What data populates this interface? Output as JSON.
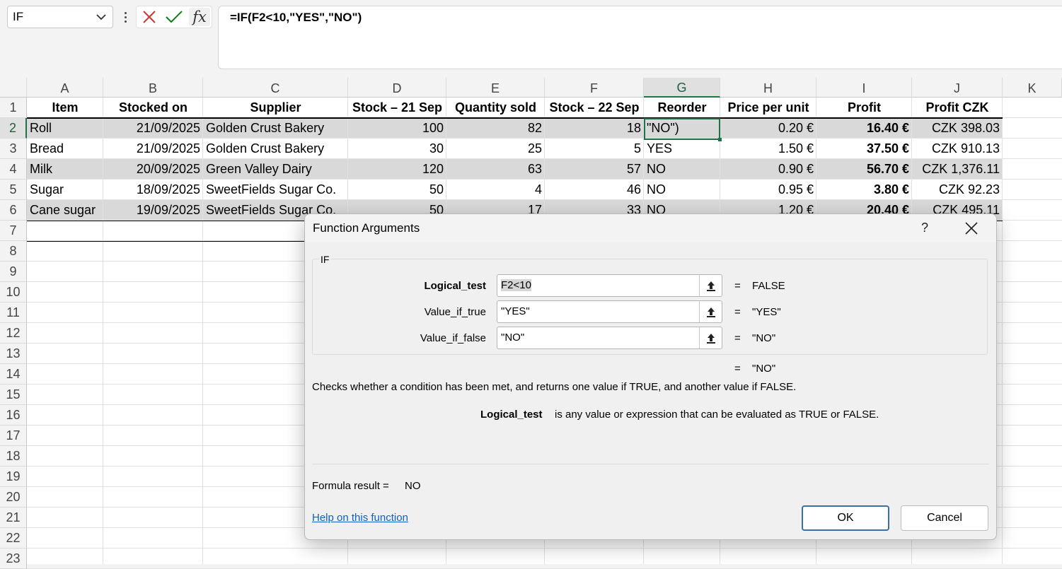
{
  "name_box": "IF",
  "formula_bar": "=IF(F2<10,\"YES\",\"NO\")",
  "columns": [
    "A",
    "B",
    "C",
    "D",
    "E",
    "F",
    "G",
    "H",
    "I",
    "J",
    "K"
  ],
  "rows": [
    "1",
    "2",
    "3",
    "4",
    "5",
    "6",
    "7",
    "8",
    "9",
    "10",
    "11",
    "12",
    "13",
    "14",
    "15",
    "16",
    "17",
    "18",
    "19",
    "20",
    "21",
    "22",
    "23"
  ],
  "headers": [
    "Item",
    "Stocked on",
    "Supplier",
    "Stock – 21 Sep",
    "Quantity sold",
    "Stock – 22 Sep",
    "Reorder",
    "Price per unit",
    "Profit",
    "Profit CZK"
  ],
  "data": [
    [
      "Roll",
      "21/09/2025",
      "Golden Crust Bakery",
      "100",
      "82",
      "18",
      "\"NO\")",
      "0.20 €",
      "16.40 €",
      "CZK 398.03"
    ],
    [
      "Bread",
      "21/09/2025",
      "Golden Crust Bakery",
      "30",
      "25",
      "5",
      "YES",
      "1.50 €",
      "37.50 €",
      "CZK 910.13"
    ],
    [
      "Milk",
      "20/09/2025",
      "Green Valley Dairy",
      "120",
      "63",
      "57",
      "NO",
      "0.90 €",
      "56.70 €",
      "CZK 1,376.11"
    ],
    [
      "Sugar",
      "18/09/2025",
      "SweetFields Sugar Co.",
      "50",
      "4",
      "46",
      "NO",
      "0.95 €",
      "3.80 €",
      "CZK 92.23"
    ],
    [
      "Cane sugar",
      "19/09/2025",
      "SweetFields Sugar Co.",
      "50",
      "17",
      "33",
      "NO",
      "1.20 €",
      "20.40 €",
      "CZK 495.11"
    ]
  ],
  "dialog": {
    "title": "Function Arguments",
    "help_glyph": "?",
    "function_name": "IF",
    "args": [
      {
        "label": "Logical_test",
        "value": "F2<10",
        "result": "FALSE"
      },
      {
        "label": "Value_if_true",
        "value": "\"YES\"",
        "result": "\"YES\""
      },
      {
        "label": "Value_if_false",
        "value": "\"NO\"",
        "result": "\"NO\""
      }
    ],
    "equals": "=",
    "overall_result": "\"NO\"",
    "description": "Checks whether a condition has been met, and returns one value if TRUE, and another value if FALSE.",
    "arg_help_name": "Logical_test",
    "arg_help_text": "is any value or expression that can be evaluated as TRUE or FALSE.",
    "formula_result_label": "Formula result =",
    "formula_result_value": "NO",
    "help_link": "Help on this function",
    "ok_label": "OK",
    "cancel_label": "Cancel"
  },
  "colors": {
    "accent_green": "#1f7346",
    "band_gray": "#d9d9d9",
    "link_blue": "#0b61c4",
    "cancel_red": "#d13438",
    "enter_green": "#107c10"
  },
  "icons": [
    "chevron-down-icon",
    "more-vertical-icon",
    "cancel-x-icon",
    "checkmark-icon",
    "fx-icon",
    "collapse-dialog-icon",
    "close-icon"
  ]
}
